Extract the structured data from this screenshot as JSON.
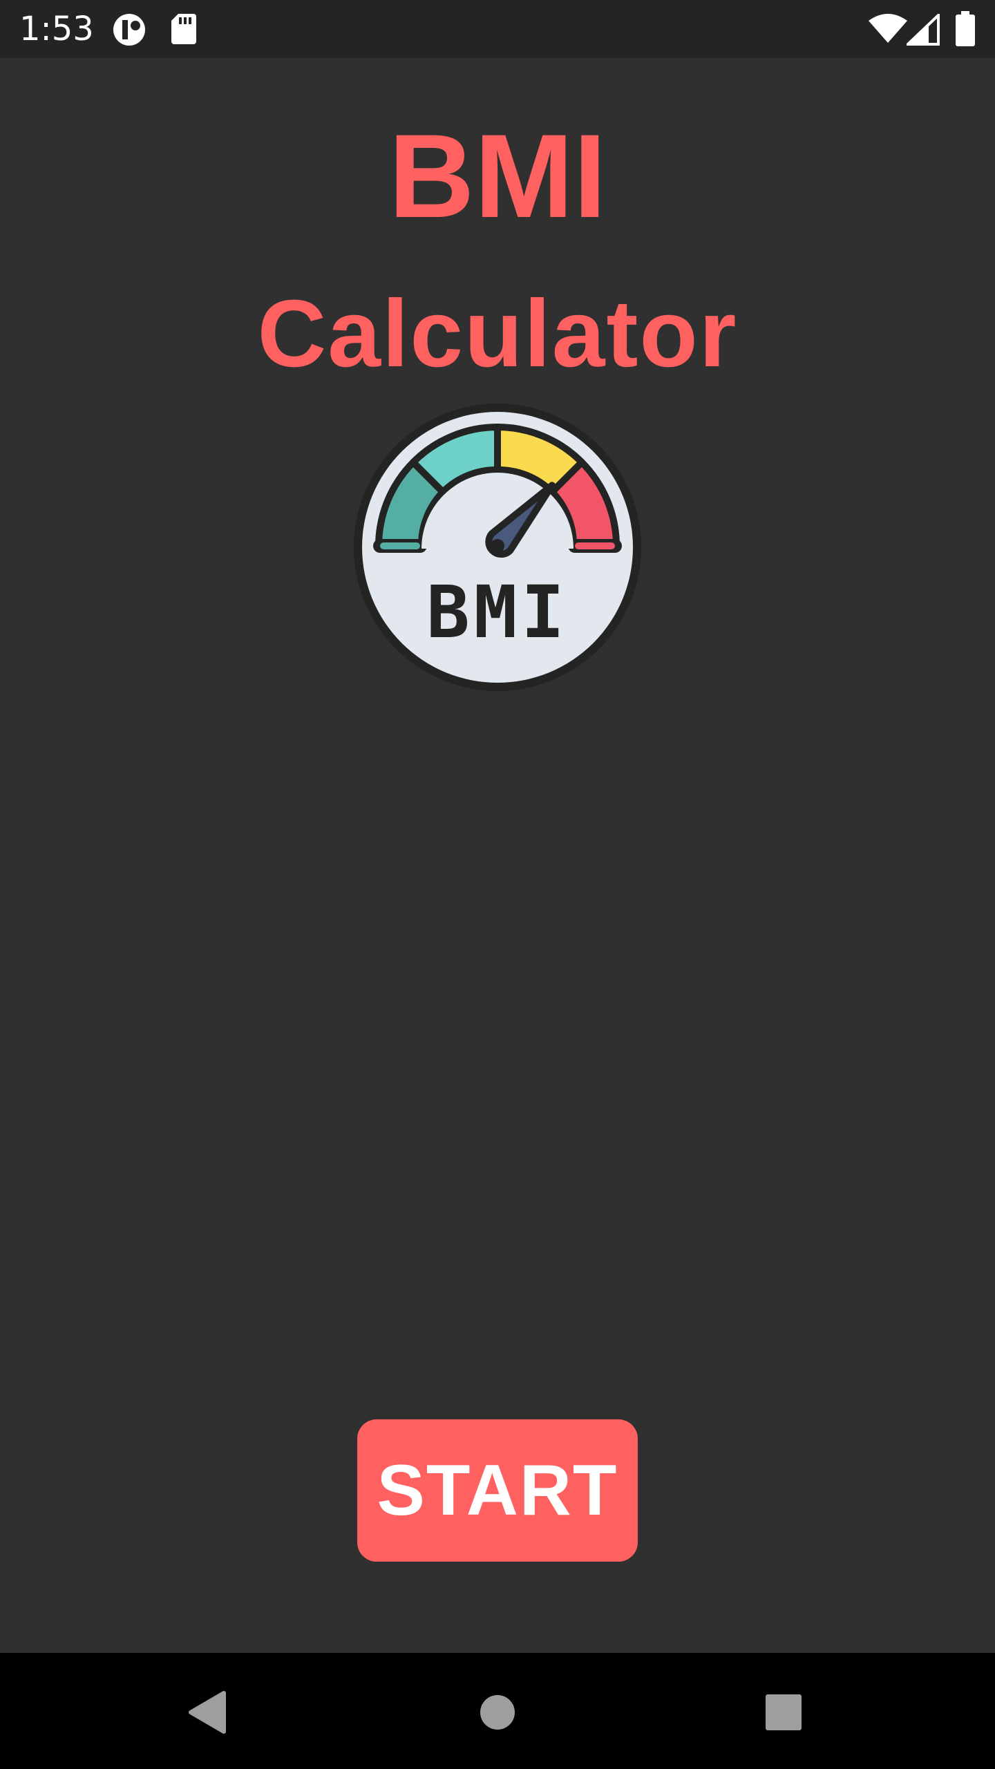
{
  "status_bar": {
    "time": "1:53",
    "left_icons": [
      "data-saver-icon",
      "sd-card-icon"
    ],
    "right_icons": [
      "wifi-icon",
      "cell-signal-icon",
      "battery-icon"
    ]
  },
  "main": {
    "title": "BMI",
    "subtitle": "Calculator",
    "gauge_icon": "bmi-gauge-icon",
    "gauge_label": "BMI",
    "start_button_label": "START"
  },
  "nav_bar": {
    "icons": [
      "back-icon",
      "home-icon",
      "recents-icon"
    ]
  },
  "colors": {
    "accent": "#FF6060",
    "background": "#303030",
    "status_bar": "#242424",
    "nav_bar": "#000000",
    "gauge_teal_dark": "#54AEA4",
    "gauge_teal_light": "#6ED1C8",
    "gauge_yellow": "#FADB50",
    "gauge_red": "#F25468",
    "gauge_face": "#E2E8EE",
    "gauge_needle": "#4A5A7E"
  }
}
